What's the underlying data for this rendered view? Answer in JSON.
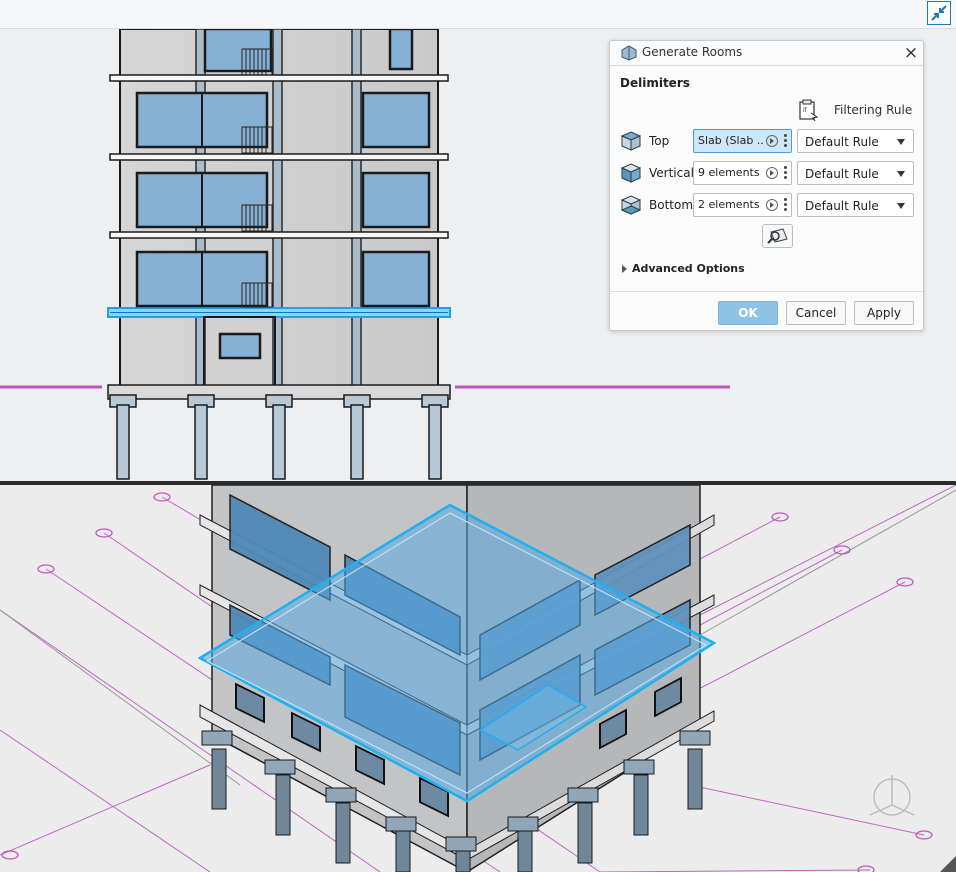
{
  "dialog": {
    "title": "Generate Rooms",
    "section_title": "Delimiters",
    "filtering_rule_label": "Filtering Rule",
    "rows": [
      {
        "label": "Top",
        "selection": "Slab (Slab ...",
        "rule": "Default Rule"
      },
      {
        "label": "Vertical",
        "selection": "9 elements",
        "rule": "Default Rule"
      },
      {
        "label": "Bottom",
        "selection": "2 elements",
        "rule": "Default Rule"
      }
    ],
    "advanced_options_label": "Advanced Options",
    "buttons": {
      "ok": "OK",
      "cancel": "Cancel",
      "apply": "Apply"
    }
  },
  "colors": {
    "highlight": "#2aa8e0",
    "glass": "#7fb0d6",
    "grid_line": "#c056c0",
    "accent": "#1c78b8"
  },
  "icons": [
    "collapse-viewport-icon",
    "generate-rooms-icon",
    "close-icon",
    "filtering-rule-icon",
    "top-delimiter-icon",
    "vertical-delimiter-icon",
    "bottom-delimiter-icon",
    "selection-navigate-icon",
    "more-options-icon",
    "dropdown-caret-icon",
    "preview-icon",
    "expand-caret-icon",
    "compass-icon"
  ]
}
